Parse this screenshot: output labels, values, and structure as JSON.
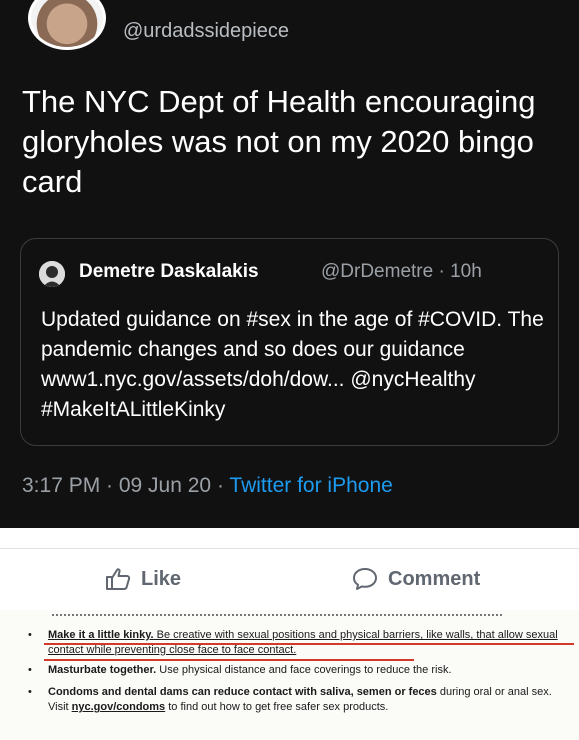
{
  "tweet": {
    "handle": "@urdadssidepiece",
    "text": "The NYC Dept of Health encouraging gloryholes was not on my 2020 bingo card",
    "quote": {
      "name": "Demetre Daskalakis",
      "handle_time": "@DrDemetre · 10h",
      "text": "Updated guidance on #sex in the age of #COVID.  The pandemic changes and so does our guidance www1.nyc.gov/assets/doh/dow... @nycHealthy #MakeItALittleKinky"
    },
    "time_date": "3:17 PM · 09 Jun 20 · ",
    "source": "Twitter for iPhone"
  },
  "facebook_bar": {
    "like_label": "Like",
    "comment_label": "Comment"
  },
  "document": {
    "bullet1_lead": "Make it a little kinky.",
    "bullet1_rest": " Be creative with sexual positions and physical barriers, like walls, that allow sexual contact while preventing close face to face contact.",
    "bullet2_lead": "Masturbate together.",
    "bullet2_rest": " Use physical distance and face coverings to reduce the risk.",
    "bullet3_lead": "Condoms and dental dams can reduce contact with saliva, semen or feces",
    "bullet3_rest": " during oral or anal sex. Visit ",
    "bullet3_link": "nyc.gov/condoms",
    "bullet3_end": " to find out how to get free safer sex products.",
    "bullet_glyph": "•"
  },
  "colors": {
    "tweet_bg": "#111111",
    "link_blue": "#1d9bf0",
    "highlight_red": "#d23a2a"
  }
}
